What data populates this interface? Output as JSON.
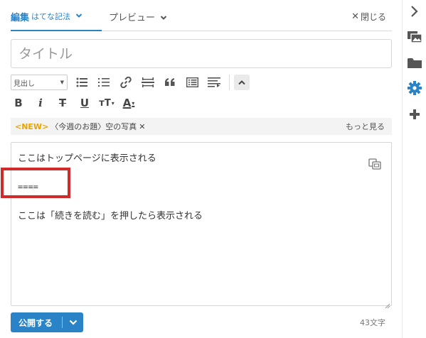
{
  "tabs": {
    "edit_label": "編集",
    "edit_mode": "はてな記法",
    "preview_label": "プレビュー",
    "close_label": "閉じる"
  },
  "title": {
    "placeholder": "タイトル",
    "value": ""
  },
  "toolbar": {
    "heading_select": "見出し",
    "format_buttons": [
      "B",
      "i",
      "T",
      "U",
      "тT",
      "A"
    ]
  },
  "topic": {
    "new_badge": "<NEW>",
    "label": "〈今週のお題〉空の写真",
    "more": "もっと見る"
  },
  "editor": {
    "lines": [
      "ここはトップページに表示される",
      "====",
      "ここは「続きを読む」を押したら表示される"
    ],
    "highlight_color": "#d12a2a"
  },
  "footer": {
    "publish_label": "公開する",
    "char_count": "43文字"
  },
  "colors": {
    "accent": "#2a83c7",
    "new_badge": "#e9a400"
  },
  "rail": {
    "icons": [
      "chevron-right-icon",
      "images-icon",
      "folder-icon",
      "gear-icon",
      "plus-icon"
    ]
  }
}
